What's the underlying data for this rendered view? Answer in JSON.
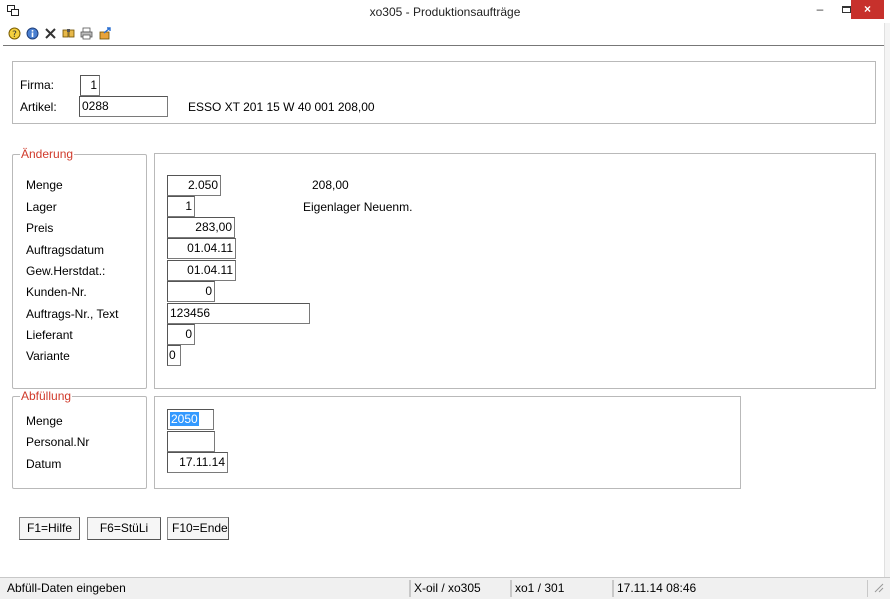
{
  "window": {
    "title": "xo305 - Produktionsaufträge",
    "minimize_label": "–",
    "close_label": "×"
  },
  "toolbar": {
    "icons": [
      "help-icon",
      "info-icon",
      "delete-icon",
      "search-icon",
      "print-icon",
      "export-icon"
    ]
  },
  "header": {
    "firma_label": "Firma:",
    "firma_value": "1",
    "artikel_label": "Artikel:",
    "artikel_value": "0288",
    "artikel_description": "ESSO XT 201 15 W 40 001 208,00"
  },
  "aenderung": {
    "legend": "Änderung",
    "menge_label": "Menge",
    "menge_value": "2.050",
    "menge_info": "208,00",
    "lager_label": "Lager",
    "lager_value": "1",
    "lager_info": "Eigenlager Neuenm.",
    "preis_label": "Preis",
    "preis_value": "283,00",
    "auftragsdatum_label": "Auftragsdatum",
    "auftragsdatum_value": "01.04.11",
    "herstdat_label": "Gew.Herstdat.:",
    "herstdat_value": "01.04.11",
    "kunden_label": "Kunden-Nr.",
    "kunden_value": "0",
    "auftragsnr_label": "Auftrags-Nr., Text",
    "auftragsnr_value": "123456",
    "lieferant_label": "Lieferant",
    "lieferant_value": "0",
    "variante_label": "Variante",
    "variante_value": "0"
  },
  "abfuellung": {
    "legend": "Abfüllung",
    "menge_label": "Menge",
    "menge_value": "2050",
    "personal_label": "Personal.Nr",
    "personal_value": "",
    "datum_label": "Datum",
    "datum_value": "17.11.14"
  },
  "function_keys": {
    "f1": "F1=Hilfe",
    "f6": "F6=StüLi",
    "f10": "F10=Ende"
  },
  "statusbar": {
    "message": "Abfüll-Daten eingeben",
    "app": "X-oil / xo305",
    "user": "xo1 / 301",
    "datetime": "17.11.14 08:46"
  }
}
